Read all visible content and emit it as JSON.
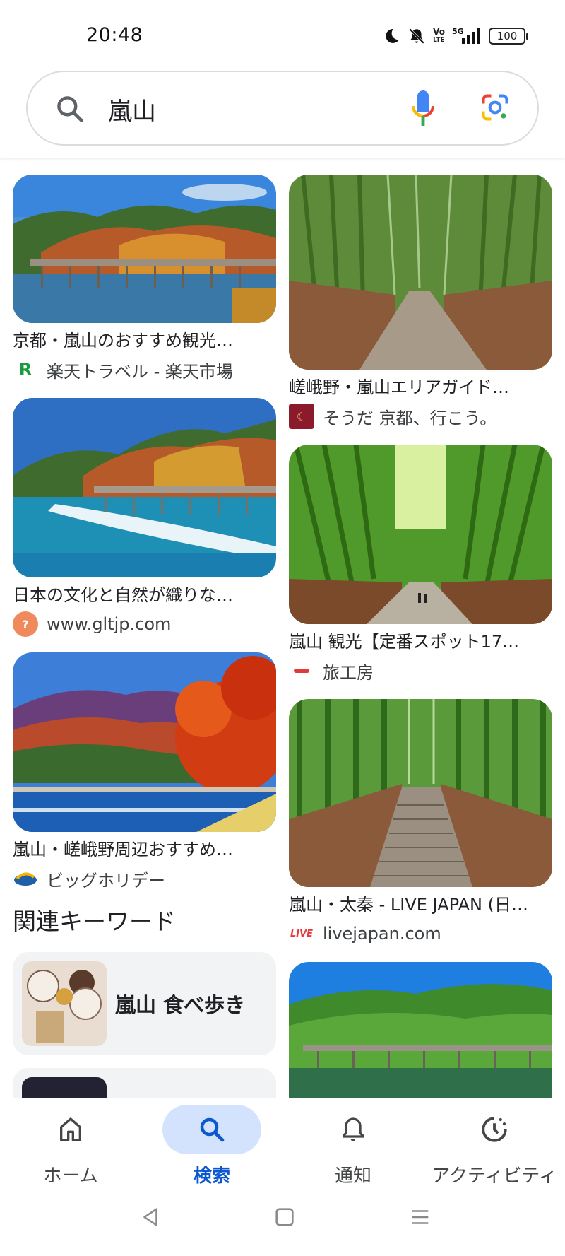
{
  "status_bar": {
    "time": "20:48",
    "icons": [
      "moon-icon",
      "bell-off-icon",
      "volte-icon",
      "5g-signal-icon",
      "battery-icon"
    ],
    "volte_top": "Vo",
    "volte_bottom": "LTE",
    "network": "5G",
    "battery": "100"
  },
  "search": {
    "query": "嵐山",
    "icons": [
      "search-icon",
      "mic-icon",
      "lens-icon"
    ]
  },
  "results": {
    "left": [
      {
        "title": "京都・嵐山のおすすめ観光…",
        "source": "楽天トラベル - 楽天市場",
        "favicon": "R",
        "favicon_color": "#1a9b3f"
      },
      {
        "title": "日本の文化と自然が織りな…",
        "source": "www.gltjp.com",
        "favicon": "?",
        "favicon_color": "#f08a5d"
      },
      {
        "title": "嵐山・嵯峨野周辺おすすめ…",
        "source": "ビッグホリデー",
        "favicon": "",
        "favicon_color": "#1f5fa8"
      }
    ],
    "right": [
      {
        "title": "嵯峨野・嵐山エリアガイド…",
        "source": "そうだ 京都、行こう。",
        "favicon": "☾",
        "favicon_color": "#8b1a2b"
      },
      {
        "title": "嵐山 観光【定番スポット17…",
        "source": "旅工房",
        "favicon": "",
        "favicon_color": "#e03a3a"
      },
      {
        "title": "嵐山・太秦 - LIVE JAPAN (日…",
        "source": "livejapan.com",
        "favicon": "LIVE",
        "favicon_color": "#e8383d"
      }
    ]
  },
  "related": {
    "heading": "関連キーワード",
    "items": [
      {
        "label": "嵐山 食べ歩き"
      }
    ]
  },
  "bottom_nav": {
    "items": [
      {
        "label": "ホーム",
        "icon": "home-icon",
        "active": false
      },
      {
        "label": "検索",
        "icon": "search-icon",
        "active": true
      },
      {
        "label": "通知",
        "icon": "bell-icon",
        "active": false
      },
      {
        "label": "アクティビティ",
        "icon": "activity-icon",
        "active": false
      }
    ],
    "active_color": "#0b57d0",
    "active_bg": "#d3e3fd"
  },
  "system_nav": [
    "back-icon",
    "home-square-icon",
    "recents-menu-icon"
  ]
}
